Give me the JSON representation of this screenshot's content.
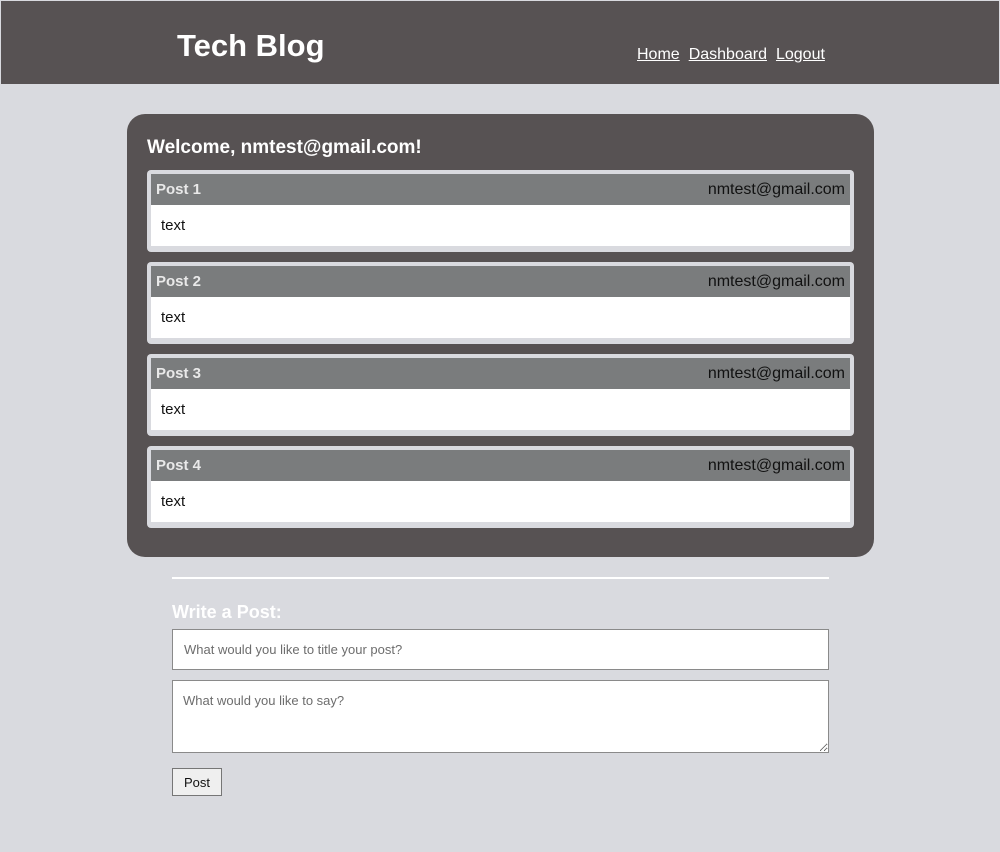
{
  "header": {
    "site_title": "Tech Blog",
    "nav": [
      {
        "label": "Home"
      },
      {
        "label": "Dashboard"
      },
      {
        "label": "Logout"
      }
    ]
  },
  "dashboard": {
    "welcome": "Welcome, nmtest@gmail.com!",
    "posts": [
      {
        "title": "Post 1",
        "author": "nmtest@gmail.com",
        "body": "text"
      },
      {
        "title": "Post 2",
        "author": "nmtest@gmail.com",
        "body": "text"
      },
      {
        "title": "Post 3",
        "author": "nmtest@gmail.com",
        "body": "text"
      },
      {
        "title": "Post 4",
        "author": "nmtest@gmail.com",
        "body": "text"
      }
    ]
  },
  "new_post": {
    "heading": "Write a Post:",
    "title_placeholder": "What would you like to title your post?",
    "title_value": "",
    "body_placeholder": "What would you like to say?",
    "body_value": "",
    "submit_label": "Post"
  },
  "colors": {
    "page_background": "#d9dadf",
    "header_background": "#575253",
    "card_background": "#575253",
    "post_header_background": "#7a7c7d"
  }
}
